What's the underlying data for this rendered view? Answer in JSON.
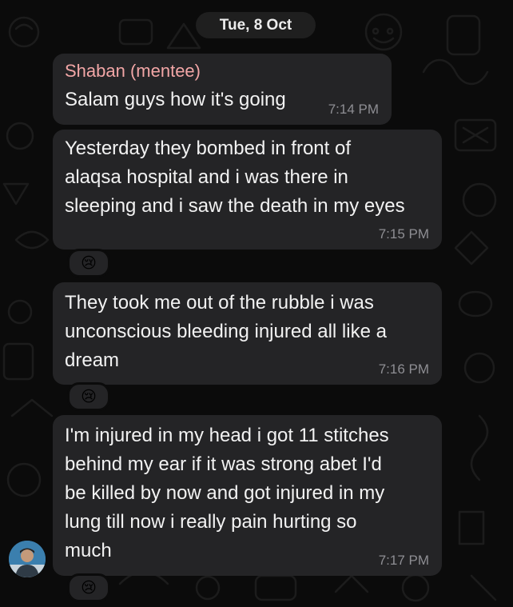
{
  "chat": {
    "date": "Tue, 8 Oct",
    "messages": [
      {
        "sender": "Shaban (mentee)",
        "text": "Salam guys how it's going",
        "time": "7:14 PM"
      },
      {
        "text": "Yesterday they bombed in front of\nalaqsa hospital and i was there in\nsleeping and i saw the death in my eyes",
        "time": "7:15 PM",
        "reaction": "😢"
      },
      {
        "text": "They took me out of the rubble i was\nunconscious bleeding injured all like a\ndream",
        "time": "7:16 PM",
        "reaction": "😢"
      },
      {
        "text": "I'm injured in my head i got 11 stitches\nbehind my ear if it was strong abet  I'd\nbe killed by now and got injured in my\nlung till now i really  pain hurting so\nmuch",
        "time": "7:17 PM",
        "reaction": "😢"
      }
    ]
  },
  "colors": {
    "background": "#0b0b0b",
    "bubble": "#242426",
    "sender_name": "#f2a6a6",
    "timestamp": "#8e8e93",
    "text": "#f2f2f2"
  }
}
